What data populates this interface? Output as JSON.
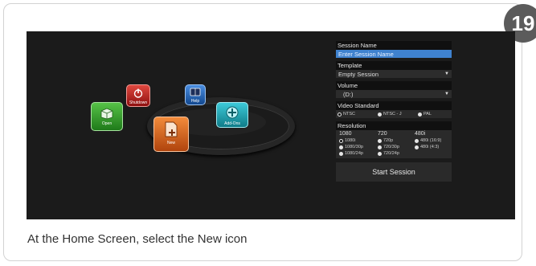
{
  "page": {
    "step_number": "19",
    "caption": "At the Home Screen, select the New icon"
  },
  "home": {
    "tiles": {
      "open": "Open",
      "shutdown": "Shutdown",
      "help": "Help",
      "addons": "Add-Ons",
      "new": "New"
    }
  },
  "panel": {
    "session_name_label": "Session Name",
    "session_name_placeholder": "Enter Session Name",
    "template_label": "Template",
    "template_value": "Empty Session",
    "volume_label": "Volume",
    "volume_value": "(D:)",
    "video_standard_label": "Video Standard",
    "video_standards": [
      "NTSC",
      "NTSC - J",
      "PAL"
    ],
    "video_standard_selected": "NTSC",
    "resolution_label": "Resolution",
    "resolution_headers": [
      "1080",
      "720",
      "480i"
    ],
    "resolutions": {
      "r1080i": "1080i",
      "r720p": "720p",
      "r480i169": "480i (16:9)",
      "r1080_30p": "1080/30p",
      "r720_30p": "720/30p",
      "r480i43": "480i (4:3)",
      "r1080_24p": "1080/24p",
      "r720_24p": "720/24p"
    },
    "resolution_selected": "1080i",
    "start_button": "Start Session"
  }
}
